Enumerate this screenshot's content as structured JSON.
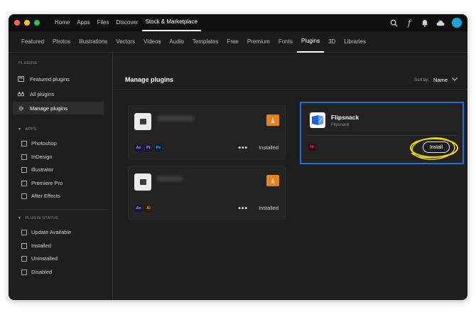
{
  "topbar": {
    "traffic_colors": [
      "#ff5f57",
      "#febc2e",
      "#28c840"
    ],
    "nav": [
      {
        "label": "Home",
        "active": false
      },
      {
        "label": "Apps",
        "active": false
      },
      {
        "label": "Files",
        "active": false
      },
      {
        "label": "Discover",
        "active": false
      },
      {
        "label": "Stock & Marketplace",
        "active": true
      }
    ],
    "icons": [
      "search-icon",
      "font-icon",
      "bell-icon",
      "cloud-icon"
    ],
    "font_glyph": "f"
  },
  "subnav": {
    "items": [
      {
        "label": "Featured",
        "active": false
      },
      {
        "label": "Photos",
        "active": false
      },
      {
        "label": "Illustrations",
        "active": false
      },
      {
        "label": "Vectors",
        "active": false
      },
      {
        "label": "Videos",
        "active": false
      },
      {
        "label": "Audio",
        "active": false
      },
      {
        "label": "Templates",
        "active": false
      },
      {
        "label": "Free",
        "active": false
      },
      {
        "label": "Premium",
        "active": false
      },
      {
        "label": "Fonts",
        "active": false
      },
      {
        "label": "Plugins",
        "active": true
      },
      {
        "label": "3D",
        "active": false
      },
      {
        "label": "Libraries",
        "active": false
      }
    ]
  },
  "sidebar": {
    "heading": "PLUGINS",
    "items": [
      {
        "label": "Featured plugins",
        "icon": "featured-icon",
        "active": false
      },
      {
        "label": "All plugins",
        "icon": "binoculars-icon",
        "active": false
      },
      {
        "label": "Manage plugins",
        "icon": "gear-icon",
        "active": true
      }
    ],
    "apps_section": {
      "title": "APPS",
      "items": [
        "Photoshop",
        "InDesign",
        "Illustrator",
        "Premiere Pro",
        "After Effects"
      ]
    },
    "status_section": {
      "title": "PLUGIN STATUS",
      "items": [
        "Update Available",
        "Installed",
        "Uninstalled",
        "Disabled"
      ]
    }
  },
  "main": {
    "title": "Manage plugins",
    "sort_label": "Sort by:",
    "sort_value": "Name",
    "cards": [
      {
        "apps": [
          {
            "code": "Ae",
            "bg": "#1a0f3d",
            "fg": "#9999ff"
          },
          {
            "code": "Pr",
            "bg": "#1a0f3d",
            "fg": "#9999ff"
          },
          {
            "code": "Ps",
            "bg": "#061e33",
            "fg": "#31a8ff"
          }
        ],
        "status": "Installed",
        "more": "•••"
      },
      {
        "apps": [
          {
            "code": "Ae",
            "bg": "#1a0f3d",
            "fg": "#9999ff"
          },
          {
            "code": "Ai",
            "bg": "#331a00",
            "fg": "#ff9a00"
          }
        ],
        "status": "Installed",
        "more": "•••"
      }
    ],
    "featured_card": {
      "name": "Flipsnack",
      "publisher": "Flipsnack",
      "app": {
        "code": "Id",
        "bg": "#3b0a1e",
        "fg": "#ff3366"
      },
      "button": "Install",
      "highlight_color": "#1f6fe0",
      "annotation_color": "#e8d21a"
    },
    "download_glyph": "⤓"
  },
  "colors": {
    "accent_orange": "#e8811f",
    "avatar": "#1aa3d9"
  }
}
